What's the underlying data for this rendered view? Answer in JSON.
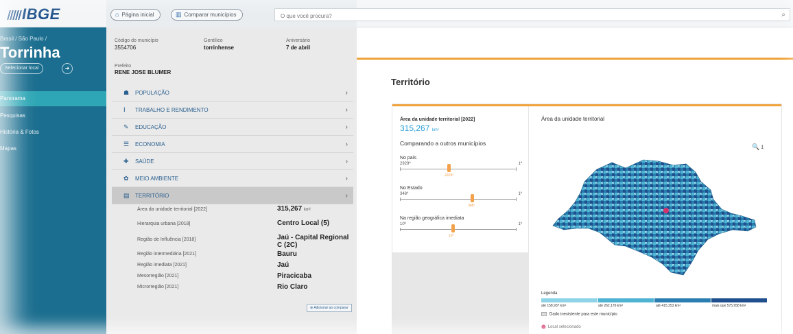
{
  "header": {
    "logo": "IBGE",
    "home_btn": "Página inicial",
    "compare_btn": "Comparar municípios",
    "search_placeholder": "O que você procura?"
  },
  "sidebar": {
    "breadcrumb": "Brasil / São Paulo /",
    "city": "Torrinha",
    "change_btn": "Selecionar local",
    "items": [
      {
        "label": "Panorama"
      },
      {
        "label": "Pesquisas"
      },
      {
        "label": "História & Fotos"
      },
      {
        "label": "Mapas"
      }
    ]
  },
  "summary": {
    "code_label": "Código do município",
    "code_value": "3554706",
    "gentilic_label": "Gentílico",
    "gentilic_value": "torrinhense",
    "anniv_label": "Aniversário",
    "anniv_value": "7 de abril",
    "mayor_label": "Prefeito",
    "mayor_value": "RENE JOSE BLUMER"
  },
  "categories": [
    {
      "icon": "people-icon",
      "glyph": "☗",
      "label": "POPULAÇÃO"
    },
    {
      "icon": "work-icon",
      "glyph": "Ⅰ",
      "label": "TRABALHO E RENDIMENTO"
    },
    {
      "icon": "education-icon",
      "glyph": "✎",
      "label": "EDUCAÇÃO"
    },
    {
      "icon": "economy-icon",
      "glyph": "☰",
      "label": "ECONOMIA"
    },
    {
      "icon": "health-icon",
      "glyph": "✚",
      "label": "SAÚDE"
    },
    {
      "icon": "environment-icon",
      "glyph": "✿",
      "label": "MEIO AMBIENTE"
    },
    {
      "icon": "territory-icon",
      "glyph": "▤",
      "label": "TERRITÓRIO"
    }
  ],
  "territory_rows": [
    {
      "key": "Área da unidade territorial [2022]",
      "value": "315,267",
      "unit": "km²"
    },
    {
      "key": "Hierarquia urbana [2018]",
      "value": "Centro Local (5)",
      "unit": ""
    },
    {
      "key": "Região de Influência [2018]",
      "value": "Jaú - Capital Regional C (2C)",
      "unit": ""
    },
    {
      "key": "Região intermediária [2021]",
      "value": "Bauru",
      "unit": ""
    },
    {
      "key": "Região imediata [2021]",
      "value": "Jaú",
      "unit": ""
    },
    {
      "key": "Mesorregião [2021]",
      "value": "Piracicaba",
      "unit": ""
    },
    {
      "key": "Microrregião [2021]",
      "value": "Rio Claro",
      "unit": ""
    }
  ],
  "add_btn": "Adicionar ao comparar",
  "main": {
    "title": "Território",
    "area_label": "Área da unidade territorial [2022]",
    "area_value": "315,267",
    "area_unit": "km²",
    "compare_title": "Comparando a outros municípios",
    "sliders": [
      {
        "name": "No país",
        "rank": "2929º",
        "end": "1º",
        "pos": 0.42,
        "mark_label": "2929º"
      },
      {
        "name": "No Estado",
        "rank": "348º",
        "end": "1º",
        "pos": 0.62,
        "mark_label": "348º"
      },
      {
        "name": "Na região geográfica imediata",
        "rank": "10º",
        "end": "1º",
        "pos": 0.45,
        "mark_label": "10º"
      }
    ],
    "map_title": "Área da unidade territorial",
    "map_tools": "🔍 ⭳",
    "legend_title": "Legenda",
    "legend_labels": [
      "até 158,937 km²",
      "até 262,176 km²",
      "até 415,253 km²",
      "mais que 575,958 km²"
    ],
    "legend_colors": [
      "#8fd3e8",
      "#4fb3d3",
      "#2b7fb0",
      "#1f4f8c"
    ],
    "legend_nodata": "Dado inexistente para este município",
    "legend_selected": "Local selecionado"
  }
}
